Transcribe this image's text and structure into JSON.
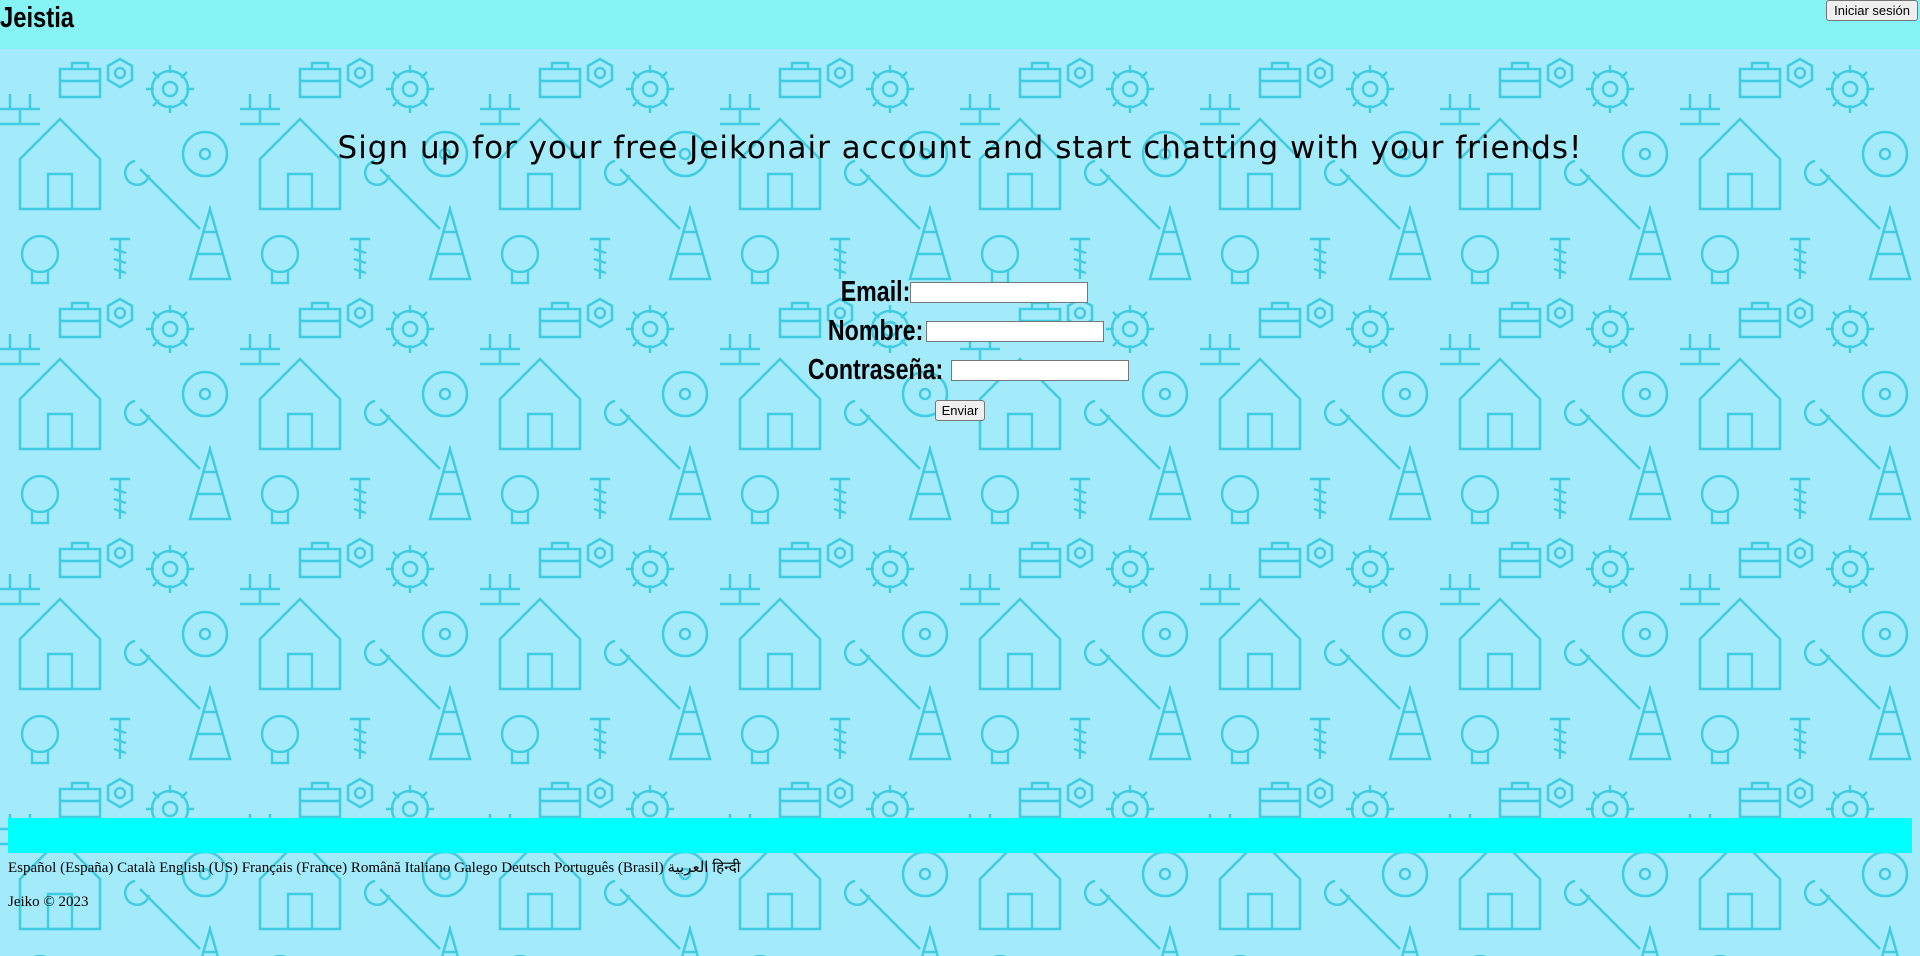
{
  "header": {
    "brand": "Jeistia",
    "login_button": "Iniciar sesión"
  },
  "main": {
    "headline": "Sign up for your free Jeikonair account and start chatting with your friends!",
    "form": {
      "email_label": "Email:",
      "name_label": "Nombre:",
      "password_label": "Contraseña:",
      "email_value": "",
      "name_value": "",
      "password_value": "",
      "submit_label": "Enviar"
    }
  },
  "footer": {
    "languages": [
      "Español (España)",
      "Català",
      "English (US)",
      "Français (France)",
      "Română",
      "Italiano",
      "Galego",
      "Deutsch",
      "Português (Brasil)",
      "العربية",
      "हिन्दी"
    ],
    "copyright": "Jeiko © 2023"
  },
  "colors": {
    "header_bg": "#86f4f4",
    "page_bg": "#a3ebfb",
    "pattern_stroke": "#2ec6dc",
    "footer_band": "#00ffff"
  },
  "background": {
    "pattern": "construction-tools-line-pattern"
  }
}
